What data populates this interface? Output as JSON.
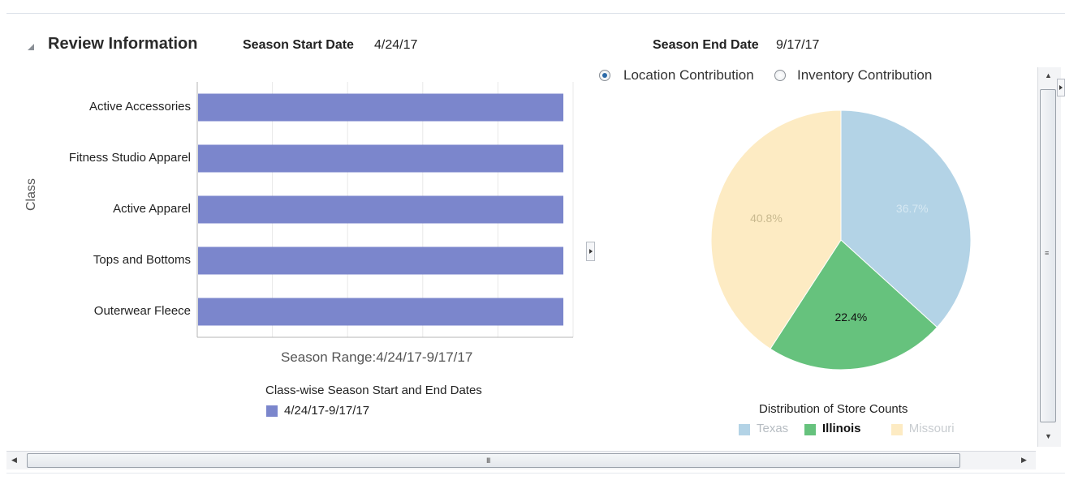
{
  "header": {
    "title": "Review Information",
    "season_start_label": "Season Start Date",
    "season_start_value": "4/24/17",
    "season_end_label": "Season End Date",
    "season_end_value": "9/17/17"
  },
  "toggle": {
    "options": [
      {
        "label": "Location Contribution",
        "selected": true
      },
      {
        "label": "Inventory Contribution",
        "selected": false
      }
    ]
  },
  "bar_chart_legend": {
    "title": "Class-wise Season Start and End Dates",
    "item": "4/24/17-9/17/17"
  },
  "pie_chart_legend": {
    "title": "Distribution of Store Counts"
  },
  "scrollbars": {
    "h_grip": "III",
    "v_grip": "≡"
  },
  "colors": {
    "bar": "#7b86cc",
    "texas": "#b3d3e6",
    "illinois": "#66c27d",
    "missouri": "#fdebc3",
    "radio_selected": "#2c6aa8"
  },
  "chart_data": [
    {
      "type": "bar",
      "orientation": "horizontal",
      "categories": [
        "Active Accessories",
        "Fitness Studio Apparel",
        "Active Apparel",
        "Tops and Bottoms",
        "Outerwear Fleece"
      ],
      "series": [
        {
          "name": "4/24/17-9/17/17",
          "start": "4/24/17",
          "end": "9/17/17",
          "values": [
            1,
            1,
            1,
            1,
            1
          ]
        }
      ],
      "xlabel": "Season Range:4/24/17-9/17/17",
      "ylabel": "Class",
      "legend_title": "Class-wise Season Start and End Dates",
      "grid": true,
      "legend_position": "bottom"
    },
    {
      "type": "pie",
      "title": "Distribution of Store Counts",
      "slices": [
        {
          "label": "Texas",
          "value": 36.7,
          "display": "36.7%"
        },
        {
          "label": "Illinois",
          "value": 22.4,
          "display": "22.4%"
        },
        {
          "label": "Missouri",
          "value": 40.8,
          "display": "40.8%"
        }
      ],
      "legend_position": "bottom"
    }
  ]
}
